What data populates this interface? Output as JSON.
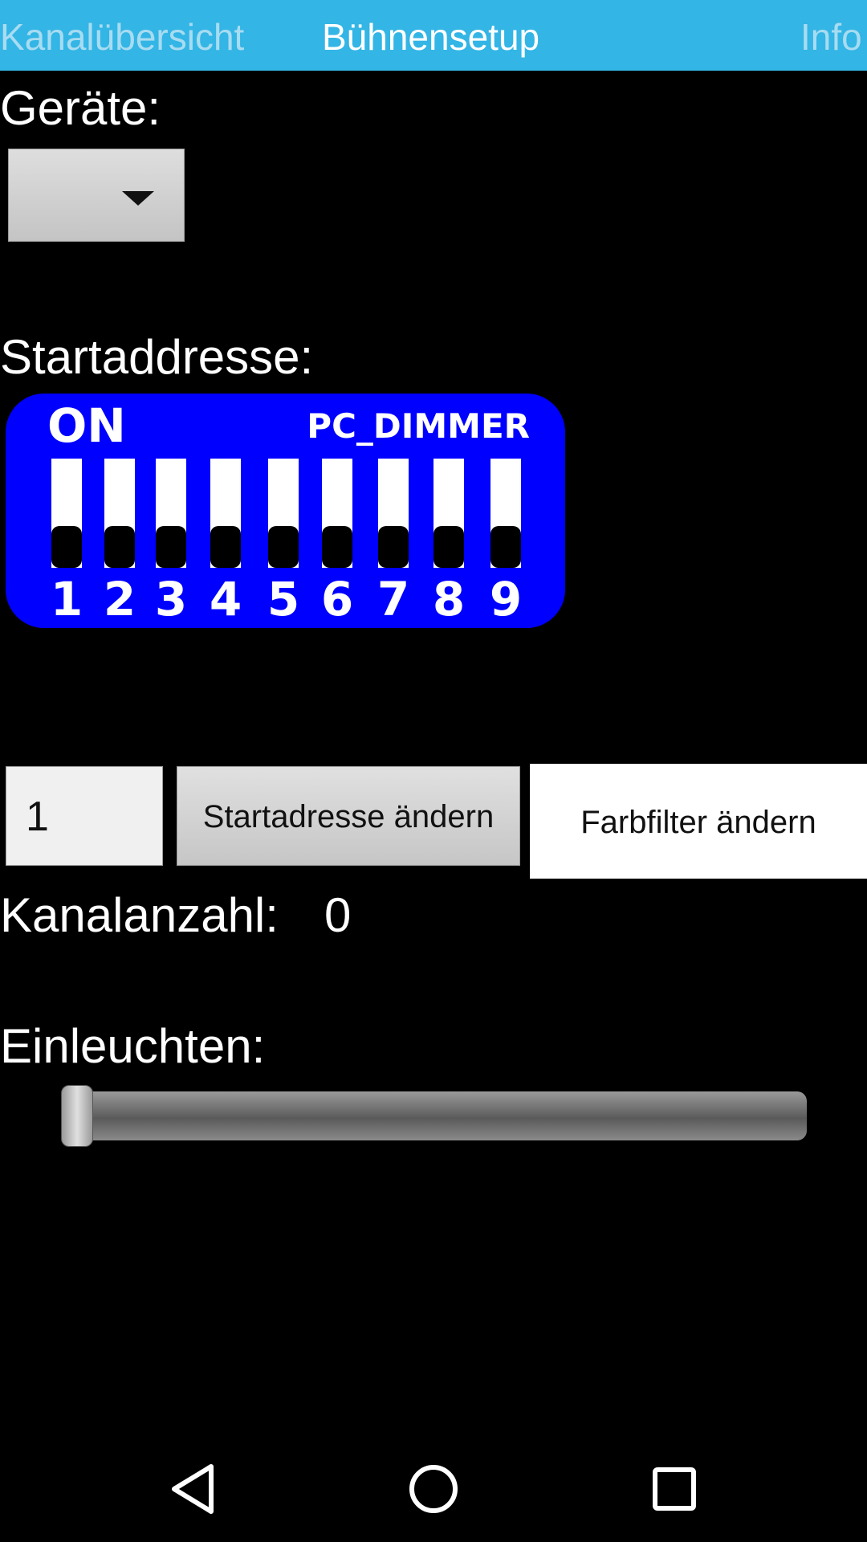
{
  "tabs": [
    {
      "label": "Kanalübersicht",
      "active": false
    },
    {
      "label": "Bühnensetup",
      "active": true
    },
    {
      "label": "Info",
      "active": false
    }
  ],
  "devices": {
    "label": "Geräte:",
    "selected": ""
  },
  "start_address": {
    "label": "Startaddresse:",
    "dip": {
      "on_label": "ON",
      "brand": "PC_DIMMER",
      "switches": [
        "1",
        "2",
        "3",
        "4",
        "5",
        "6",
        "7",
        "8",
        "9"
      ]
    },
    "input_value": "1",
    "change_button": "Startadresse ändern"
  },
  "color_filter_button": "Farbfilter ändern",
  "channel_count": {
    "label": "Kanalanzahl:",
    "value": "0"
  },
  "illumination": {
    "label": "Einleuchten:",
    "slider_value": 0
  },
  "colors": {
    "tab_bar": "#33b5e5",
    "dip_body": "#0000ff"
  },
  "nav": {
    "icons": [
      "back-icon",
      "home-icon",
      "recents-icon"
    ]
  }
}
